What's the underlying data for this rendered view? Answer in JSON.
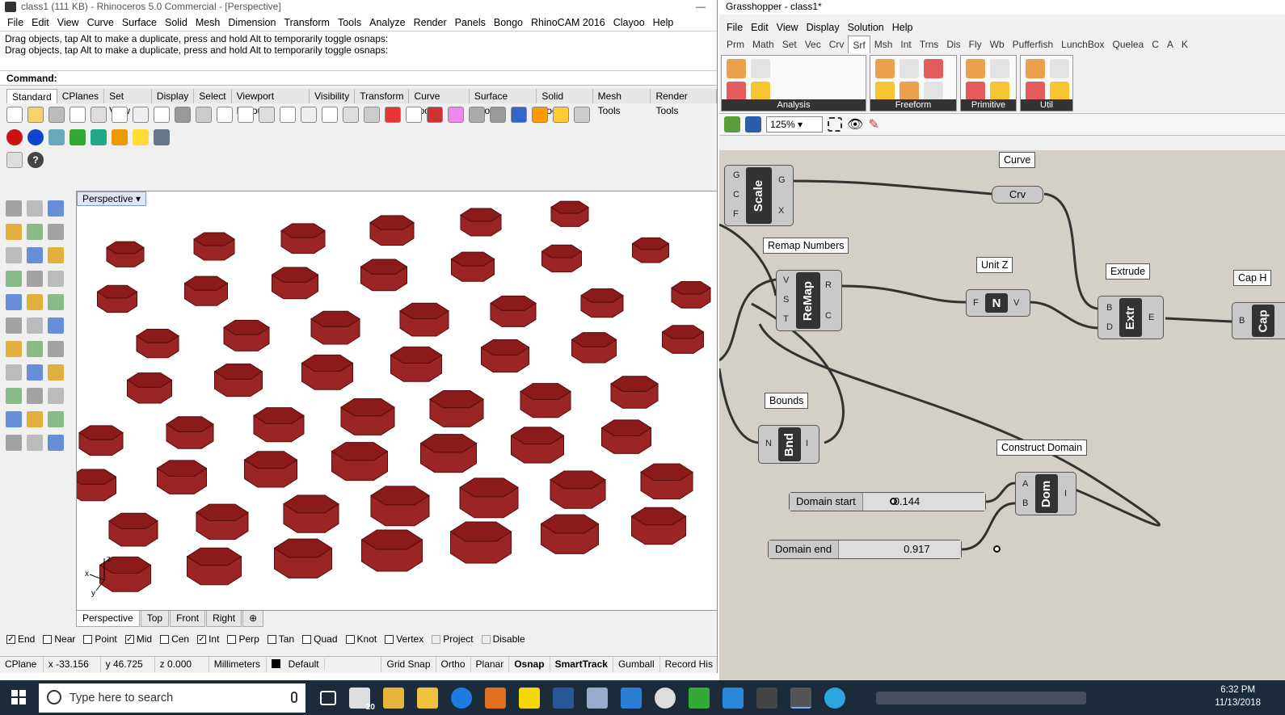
{
  "rhino": {
    "title": "class1 (111 KB) - Rhinoceros 5.0 Commercial - [Perspective]",
    "menu": [
      "File",
      "Edit",
      "View",
      "Curve",
      "Surface",
      "Solid",
      "Mesh",
      "Dimension",
      "Transform",
      "Tools",
      "Analyze",
      "Render",
      "Panels",
      "Bongo",
      "RhinoCAM 2016",
      "Clayoo",
      "Help"
    ],
    "history": [
      "Drag objects, tap Alt to make a duplicate, press and hold Alt to temporarily toggle osnaps:",
      "Drag objects, tap Alt to make a duplicate, press and hold Alt to temporarily toggle osnaps:"
    ],
    "command_label": "Command:",
    "toolbar_tabs": [
      "Standard",
      "CPlanes",
      "Set View",
      "Display",
      "Select",
      "Viewport Layout",
      "Visibility",
      "Transform",
      "Curve Tools",
      "Surface Tools",
      "Solid Tools",
      "Mesh Tools",
      "Render Tools"
    ],
    "viewport_name": "Perspective",
    "axis": {
      "z": "z",
      "x": "x",
      "y": "y"
    },
    "view_tabs": [
      "Perspective",
      "Top",
      "Front",
      "Right"
    ],
    "add_tab_glyph": "⊕",
    "osnaps": [
      {
        "label": "End",
        "checked": true
      },
      {
        "label": "Near",
        "checked": false
      },
      {
        "label": "Point",
        "checked": false
      },
      {
        "label": "Mid",
        "checked": true
      },
      {
        "label": "Cen",
        "checked": false
      },
      {
        "label": "Int",
        "checked": true
      },
      {
        "label": "Perp",
        "checked": false
      },
      {
        "label": "Tan",
        "checked": false
      },
      {
        "label": "Quad",
        "checked": false
      },
      {
        "label": "Knot",
        "checked": false
      },
      {
        "label": "Vertex",
        "checked": false
      },
      {
        "label": "Project",
        "checked": false,
        "disabled": true
      },
      {
        "label": "Disable",
        "checked": false,
        "disabled": true
      }
    ],
    "status": {
      "cplane": "CPlane",
      "x": "x -33.156",
      "y": "y 46.725",
      "z": "z 0.000",
      "units": "Millimeters",
      "layer": "Default",
      "grid_snap": "Grid Snap",
      "ortho": "Ortho",
      "planar": "Planar",
      "osnap": "Osnap",
      "smarttrack": "SmartTrack",
      "gumball": "Gumball",
      "record": "Record His"
    },
    "accent_color": "#8b1a1a"
  },
  "gh": {
    "title": "Grasshopper - class1*",
    "menu": [
      "File",
      "Edit",
      "View",
      "Display",
      "Solution",
      "Help"
    ],
    "tabs": [
      "Prm",
      "Math",
      "Set",
      "Vec",
      "Crv",
      "Srf",
      "Msh",
      "Int",
      "Trns",
      "Dis",
      "Fly",
      "Wb",
      "Pufferfish",
      "LunchBox",
      "Quelea",
      "C",
      "A",
      "K"
    ],
    "active_tab": "Srf",
    "panels": [
      "Analysis",
      "Freeform",
      "Primitive",
      "Util"
    ],
    "zoom": "125%",
    "components": {
      "scale": {
        "name": "Scale",
        "inputs": [
          "G",
          "C",
          "F"
        ],
        "outputs": [
          "G",
          "X"
        ]
      },
      "crv": {
        "name": "Crv",
        "label": "Curve"
      },
      "remap": {
        "name": "ReMap",
        "label": "Remap Numbers",
        "inputs": [
          "V",
          "S",
          "T"
        ],
        "outputs": [
          "R",
          "C"
        ]
      },
      "unitz": {
        "name": "N",
        "label": "Unit Z",
        "input": "F",
        "output": "V"
      },
      "extrude": {
        "name": "Extr",
        "label": "Extrude",
        "inputs": [
          "B",
          "D"
        ],
        "output": "E"
      },
      "cap": {
        "name": "Cap",
        "label": "Cap H",
        "input": "B"
      },
      "bounds": {
        "name": "Bnd",
        "label": "Bounds",
        "input": "N",
        "output": "I"
      },
      "domain": {
        "name": "Dom",
        "label": "Construct Domain",
        "inputs": [
          "A",
          "B"
        ],
        "output": "I"
      }
    },
    "sliders": [
      {
        "name": "Domain start",
        "value": "0.144",
        "fraction": 0.144
      },
      {
        "name": "Domain end",
        "value": "0.917",
        "fraction": 0.917
      }
    ]
  },
  "taskbar": {
    "search_placeholder": "Type here to search",
    "time": "6:32 PM",
    "date": "11/13/2018",
    "mail_badge": "20"
  }
}
